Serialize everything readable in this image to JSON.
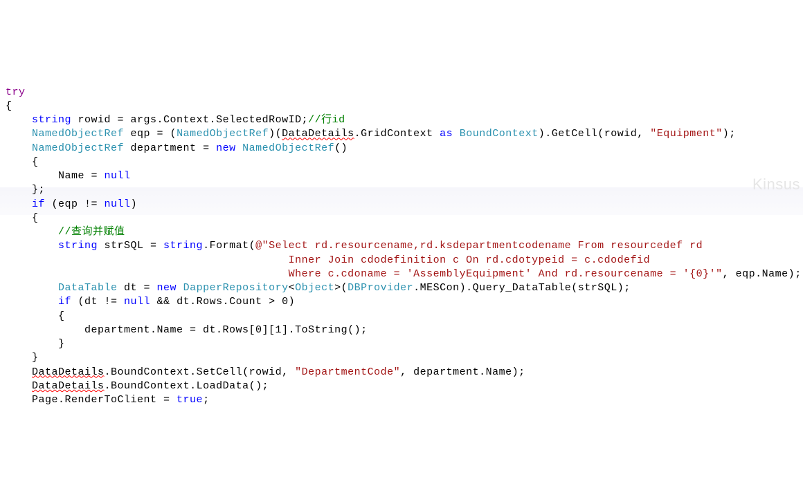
{
  "watermark": "Kinsus",
  "code": {
    "tokens": [
      {
        "t": "try",
        "c": "kw-purple"
      },
      {
        "t": "\n"
      },
      {
        "t": "{"
      },
      {
        "t": "\n"
      },
      {
        "t": "    "
      },
      {
        "t": "string",
        "c": "kw-blue"
      },
      {
        "t": " rowid = args.Context.SelectedRowID;"
      },
      {
        "t": "//行id",
        "c": "comment-green"
      },
      {
        "t": "\n"
      },
      {
        "t": "    "
      },
      {
        "t": "NamedObjectRef",
        "c": "type-teal"
      },
      {
        "t": " eqp = ("
      },
      {
        "t": "NamedObjectRef",
        "c": "type-teal"
      },
      {
        "t": ")("
      },
      {
        "t": "DataDetails",
        "squig": true
      },
      {
        "t": ".GridContext "
      },
      {
        "t": "as",
        "c": "kw-blue"
      },
      {
        "t": " "
      },
      {
        "t": "BoundContext",
        "c": "type-teal"
      },
      {
        "t": ").GetCell(rowid, "
      },
      {
        "t": "\"Equipment\"",
        "c": "str-red"
      },
      {
        "t": ");"
      },
      {
        "t": "\n"
      },
      {
        "t": "    "
      },
      {
        "t": "NamedObjectRef",
        "c": "type-teal"
      },
      {
        "t": " department = "
      },
      {
        "t": "new",
        "c": "kw-blue"
      },
      {
        "t": " "
      },
      {
        "t": "NamedObjectRef",
        "c": "type-teal"
      },
      {
        "t": "()"
      },
      {
        "t": "\n"
      },
      {
        "t": "    {"
      },
      {
        "t": "\n"
      },
      {
        "t": "        Name = "
      },
      {
        "t": "null",
        "c": "kw-blue"
      },
      {
        "t": "\n"
      },
      {
        "t": "    };"
      },
      {
        "t": "\n"
      },
      {
        "t": "    "
      },
      {
        "t": "if",
        "c": "kw-blue"
      },
      {
        "t": " (eqp != "
      },
      {
        "t": "null",
        "c": "kw-blue"
      },
      {
        "t": ")"
      },
      {
        "t": "\n"
      },
      {
        "t": "    {"
      },
      {
        "t": "\n"
      },
      {
        "t": "        "
      },
      {
        "t": "//查询并赋值",
        "c": "comment-green"
      },
      {
        "t": "\n"
      },
      {
        "t": "        "
      },
      {
        "t": "string",
        "c": "kw-blue"
      },
      {
        "t": " strSQL = "
      },
      {
        "t": "string",
        "c": "kw-blue"
      },
      {
        "t": ".Format("
      },
      {
        "t": "@\"Select rd.resourcename,rd.ksdepartmentcodename From resourcedef rd",
        "c": "str-red"
      },
      {
        "t": "\n"
      },
      {
        "t": "                                           Inner Join cdodefinition c On rd.cdotypeid = c.cdodefid",
        "c": "str-red"
      },
      {
        "t": "\n"
      },
      {
        "t": "                                           Where c.cdoname = 'AssemblyEquipment' And rd.resourcename = '{0}'\"",
        "c": "str-red"
      },
      {
        "t": ", eqp.Name);"
      },
      {
        "t": "\n"
      },
      {
        "t": "        "
      },
      {
        "t": "DataTable",
        "c": "type-teal"
      },
      {
        "t": " dt = "
      },
      {
        "t": "new",
        "c": "kw-blue"
      },
      {
        "t": " "
      },
      {
        "t": "DapperRepository",
        "c": "type-teal"
      },
      {
        "t": "<"
      },
      {
        "t": "Object",
        "c": "type-teal"
      },
      {
        "t": ">("
      },
      {
        "t": "DBProvider",
        "c": "type-teal"
      },
      {
        "t": ".MESCon).Query_DataTable(strSQL);"
      },
      {
        "t": "\n"
      },
      {
        "t": "        "
      },
      {
        "t": "if",
        "c": "kw-blue"
      },
      {
        "t": " (dt != "
      },
      {
        "t": "null",
        "c": "kw-blue"
      },
      {
        "t": " && dt.Rows.Count > 0)"
      },
      {
        "t": "\n"
      },
      {
        "t": "        {"
      },
      {
        "t": "\n"
      },
      {
        "t": "            department.Name = dt.Rows[0][1].ToString();"
      },
      {
        "t": "\n"
      },
      {
        "t": "        }"
      },
      {
        "t": "\n"
      },
      {
        "t": "    }"
      },
      {
        "t": "\n"
      },
      {
        "t": "    "
      },
      {
        "t": "DataDetails",
        "squig": true
      },
      {
        "t": ".BoundContext.SetCell(rowid, "
      },
      {
        "t": "\"DepartmentCode\"",
        "c": "str-red"
      },
      {
        "t": ", department.Name);"
      },
      {
        "t": "\n"
      },
      {
        "t": "    "
      },
      {
        "t": "DataDetails",
        "squig": true
      },
      {
        "t": ".BoundContext.LoadData();"
      },
      {
        "t": "\n"
      },
      {
        "t": "    Page.RenderToClient = "
      },
      {
        "t": "true",
        "c": "kw-blue"
      },
      {
        "t": ";"
      }
    ]
  }
}
